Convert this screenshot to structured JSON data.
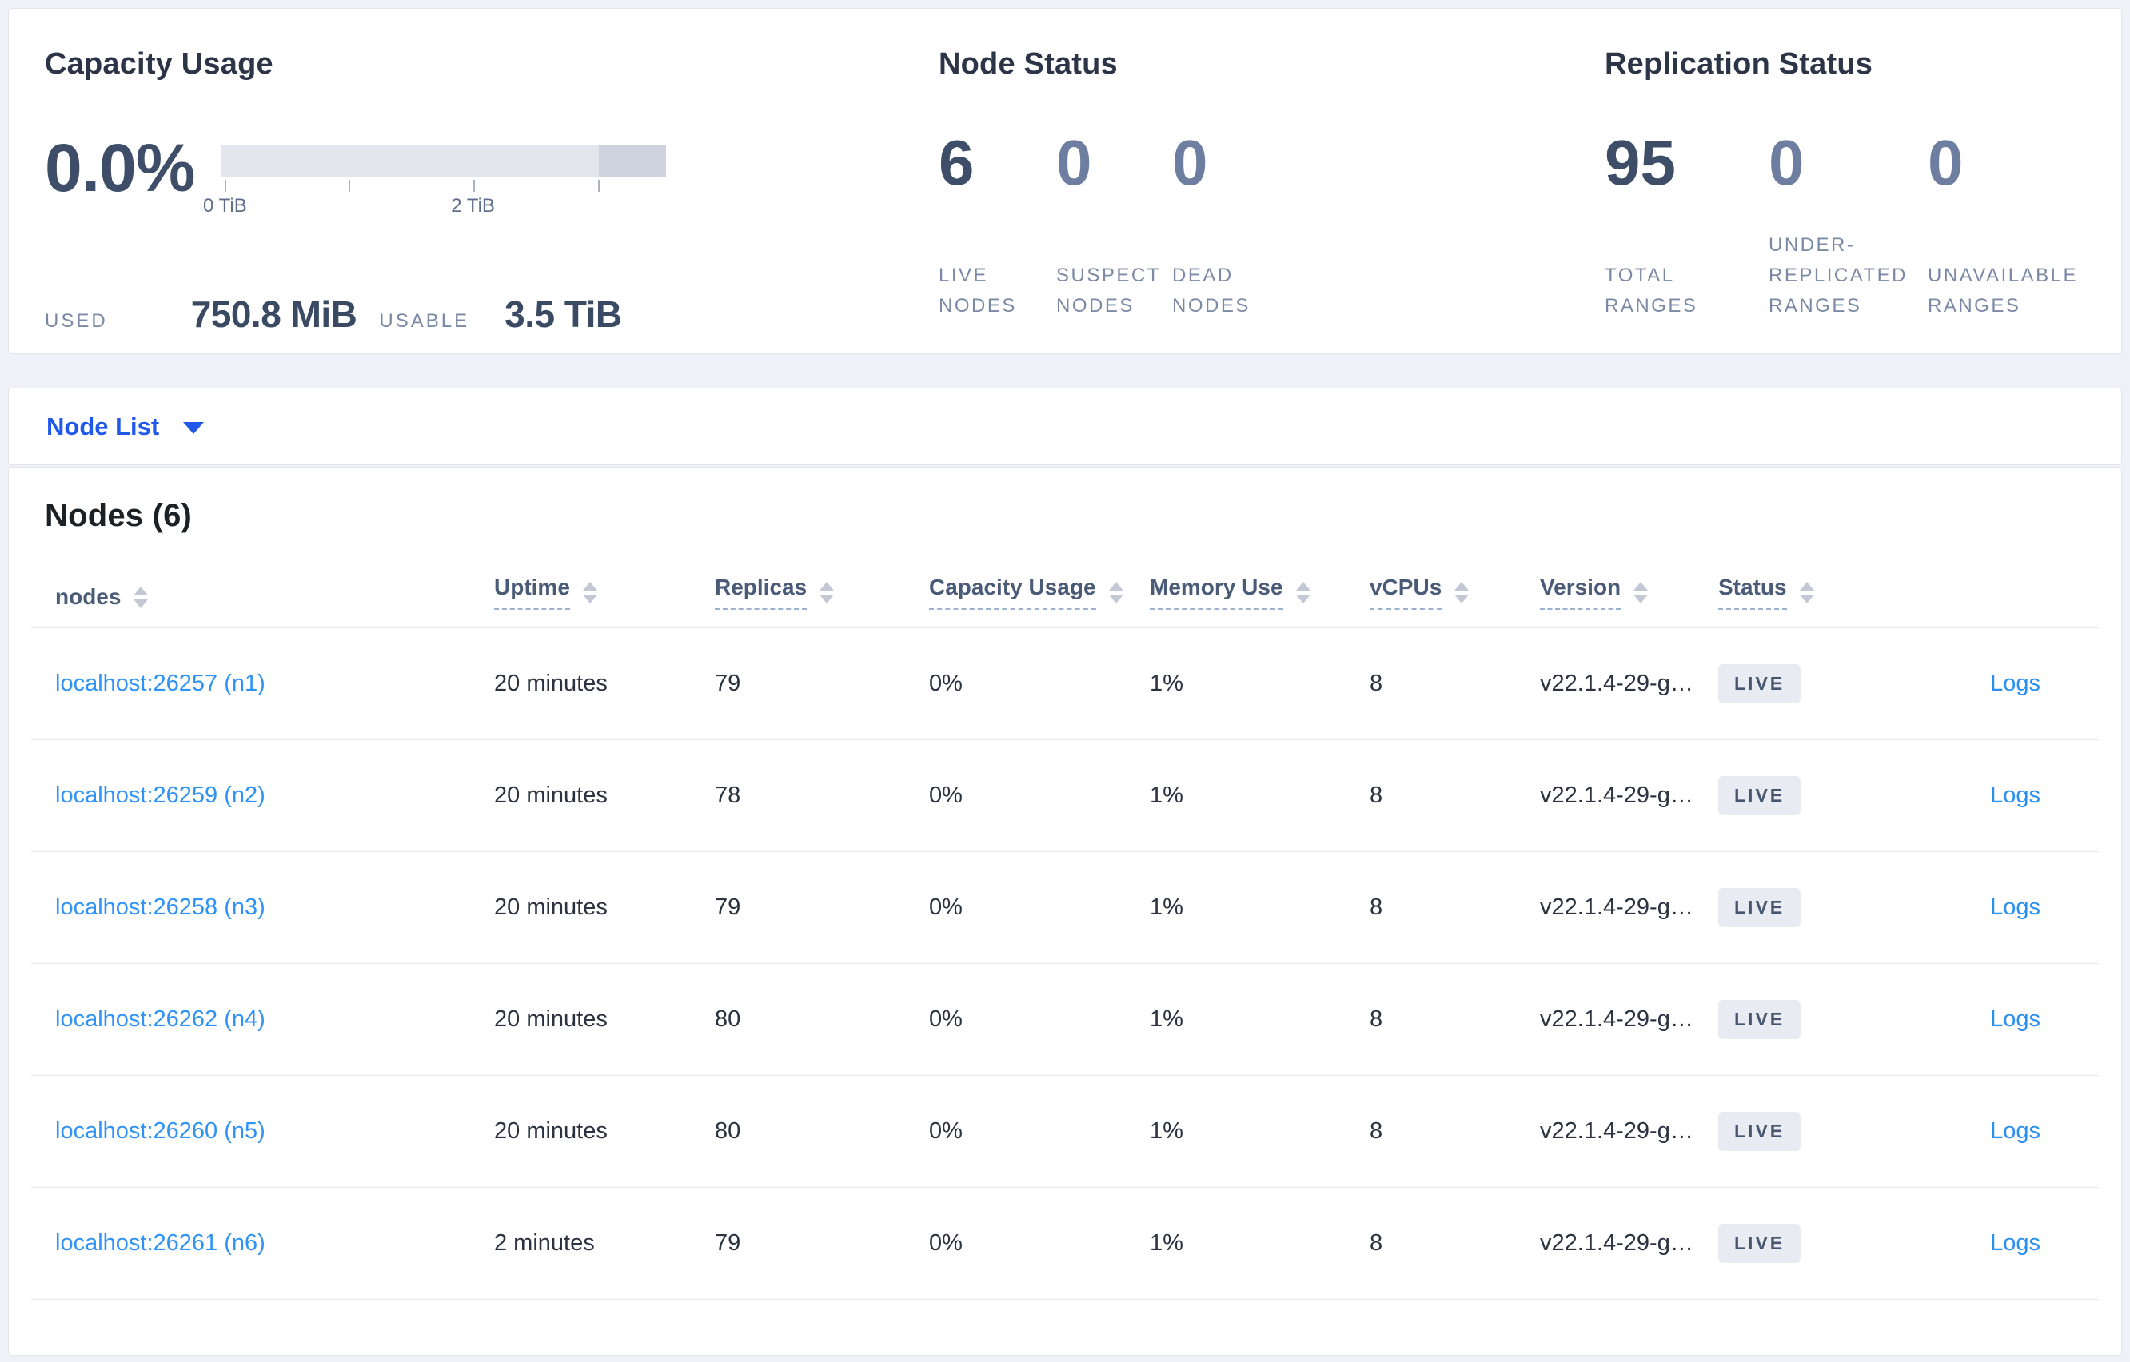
{
  "colors": {
    "page_background": "#eef1f6",
    "card_background": "#ffffff",
    "link_blue": "#2f93f6",
    "dropdown_blue": "#2058e8",
    "stat_number_dark": "#3e4e68",
    "stat_number_muted": "#6e7ea0",
    "bar_track": "#e3e6ed",
    "bar_segment": "#ced3df",
    "badge_background": "#e8ebf1",
    "badge_text": "#46556e"
  },
  "capacity_usage": {
    "title": "Capacity Usage",
    "percent": "0.0%",
    "used_label": "USED",
    "used_value": "750.8 MiB",
    "usable_label": "USABLE",
    "usable_value": "3.5 TiB",
    "bar": {
      "type": "bar",
      "unit": "TiB",
      "ticks_tib": [
        0,
        1,
        2,
        3
      ],
      "tick_positions_pct": [
        0.7,
        28.6,
        56.5,
        84.6
      ],
      "tick_labels": [
        "0 TiB",
        "",
        "2 TiB",
        ""
      ],
      "segment_start_pct": 84.8,
      "segment_width_pct": 15.2
    }
  },
  "node_status": {
    "title": "Node Status",
    "stats": [
      {
        "value": "6",
        "label": "LIVE\nNODES"
      },
      {
        "value": "0",
        "label": "SUSPECT\nNODES"
      },
      {
        "value": "0",
        "label": "DEAD\nNODES"
      }
    ]
  },
  "replication_status": {
    "title": "Replication Status",
    "stats": [
      {
        "value": "95",
        "label": "TOTAL\nRANGES"
      },
      {
        "value": "0",
        "label": "UNDER-\nREPLICATED\nRANGES"
      },
      {
        "value": "0",
        "label": "UNAVAILABLE\nRANGES"
      }
    ]
  },
  "node_list": {
    "label": "Node List"
  },
  "nodes_table": {
    "title": "Nodes (6)",
    "columns": [
      {
        "label": "nodes"
      },
      {
        "label": "Uptime"
      },
      {
        "label": "Replicas"
      },
      {
        "label": "Capacity Usage"
      },
      {
        "label": "Memory Use"
      },
      {
        "label": "vCPUs"
      },
      {
        "label": "Version"
      },
      {
        "label": "Status"
      }
    ],
    "rows": [
      {
        "address": "localhost:26257 (n1)",
        "uptime": "20 minutes",
        "replicas": "79",
        "capacity": "0%",
        "memory": "1%",
        "vcpus": "8",
        "version": "v22.1.4-29-g…",
        "status": "LIVE",
        "logs": "Logs"
      },
      {
        "address": "localhost:26259 (n2)",
        "uptime": "20 minutes",
        "replicas": "78",
        "capacity": "0%",
        "memory": "1%",
        "vcpus": "8",
        "version": "v22.1.4-29-g…",
        "status": "LIVE",
        "logs": "Logs"
      },
      {
        "address": "localhost:26258 (n3)",
        "uptime": "20 minutes",
        "replicas": "79",
        "capacity": "0%",
        "memory": "1%",
        "vcpus": "8",
        "version": "v22.1.4-29-g…",
        "status": "LIVE",
        "logs": "Logs"
      },
      {
        "address": "localhost:26262 (n4)",
        "uptime": "20 minutes",
        "replicas": "80",
        "capacity": "0%",
        "memory": "1%",
        "vcpus": "8",
        "version": "v22.1.4-29-g…",
        "status": "LIVE",
        "logs": "Logs"
      },
      {
        "address": "localhost:26260 (n5)",
        "uptime": "20 minutes",
        "replicas": "80",
        "capacity": "0%",
        "memory": "1%",
        "vcpus": "8",
        "version": "v22.1.4-29-g…",
        "status": "LIVE",
        "logs": "Logs"
      },
      {
        "address": "localhost:26261 (n6)",
        "uptime": "2 minutes",
        "replicas": "79",
        "capacity": "0%",
        "memory": "1%",
        "vcpus": "8",
        "version": "v22.1.4-29-g…",
        "status": "LIVE",
        "logs": "Logs"
      }
    ]
  }
}
